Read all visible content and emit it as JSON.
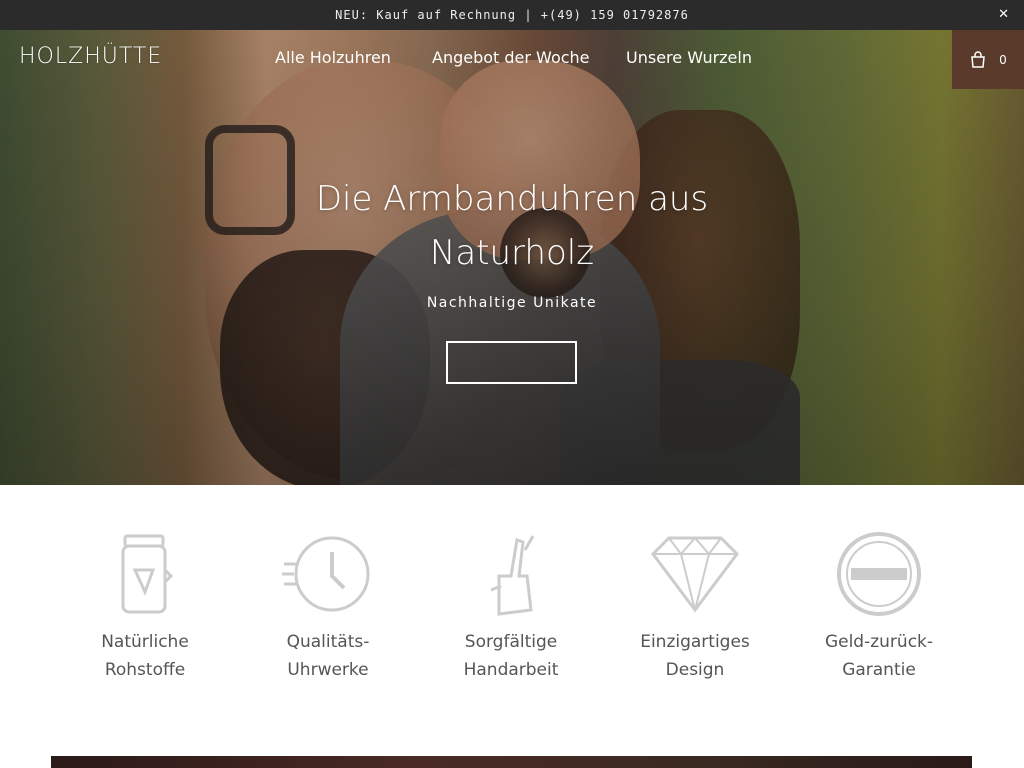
{
  "announcement": {
    "text": "NEU: Kauf auf Rechnung | +(49) 159 01792876",
    "close_icon": "close-icon"
  },
  "header": {
    "logo": "HOLZHÜTTE",
    "menu": [
      "Alle Holzuhren",
      "Angebot der Woche",
      "Unsere Wurzeln"
    ],
    "cart_count": "0",
    "cart_icon": "shopping-bag-icon",
    "cart_bg": "#5a3a2a"
  },
  "hero": {
    "title": "Die Armbanduhren aus Naturholz",
    "subtitle": "Nachhaltige Unikate",
    "button_label": ""
  },
  "features": [
    {
      "icon": "jar-icon",
      "label_line1": "Natürliche",
      "label_line2": "Rohstoffe"
    },
    {
      "icon": "clock-icon",
      "label_line1": "Qualitäts-",
      "label_line2": "Uhrwerke"
    },
    {
      "icon": "hand-icon",
      "label_line1": "Sorgfältige",
      "label_line2": "Handarbeit"
    },
    {
      "icon": "diamond-icon",
      "label_line1": "Einzigartiges",
      "label_line2": "Design"
    },
    {
      "icon": "badge-icon",
      "label_line1": "Geld-zurück-",
      "label_line2": "Garantie"
    }
  ]
}
